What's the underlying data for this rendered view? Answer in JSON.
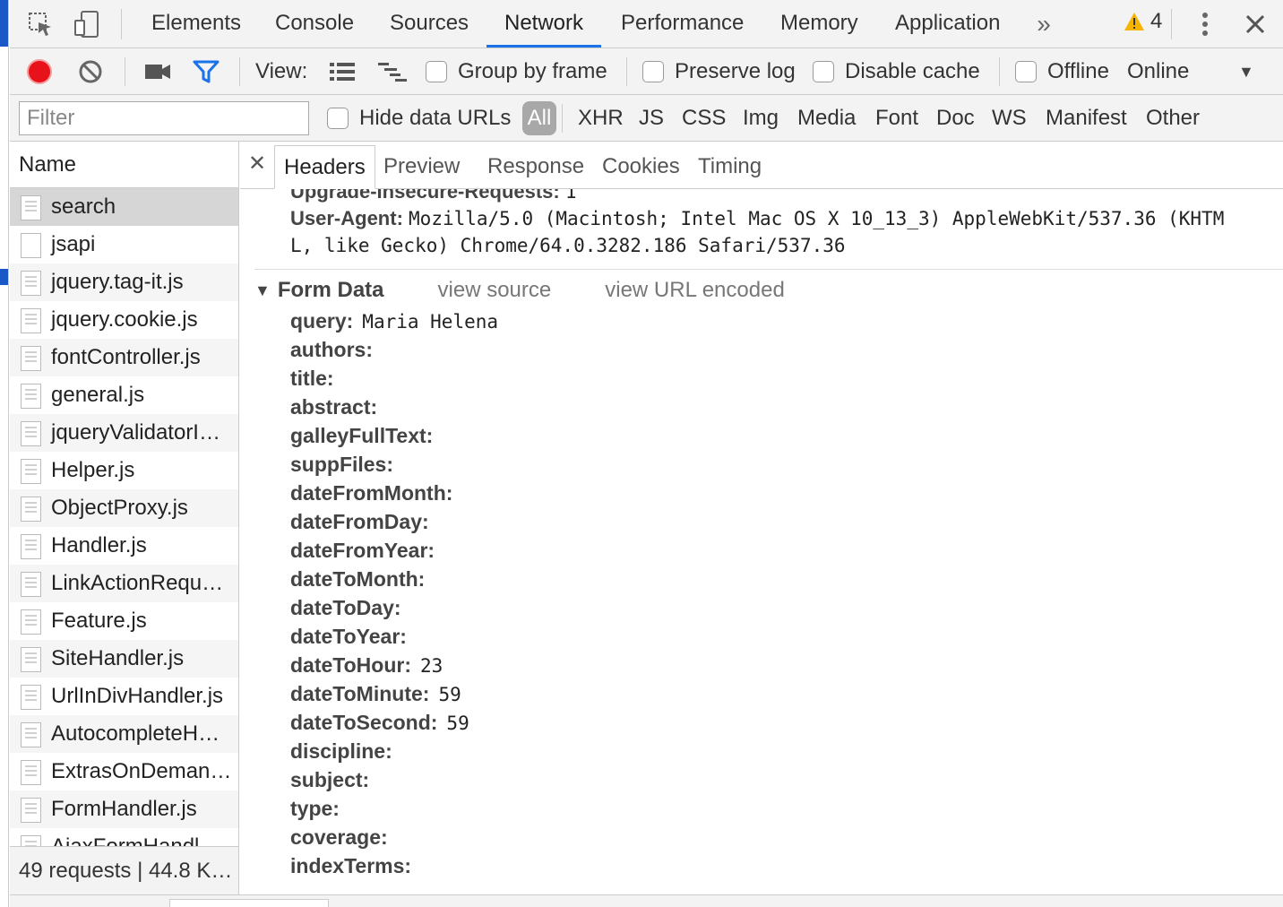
{
  "top_tabs": [
    "Elements",
    "Console",
    "Sources",
    "Network",
    "Performance",
    "Memory",
    "Application"
  ],
  "active_top_tab": "Network",
  "warning_count": "4",
  "toolbar": {
    "view_label": "View:",
    "group_by_frame": "Group by frame",
    "preserve_log": "Preserve log",
    "disable_cache": "Disable cache",
    "offline": "Offline",
    "throttle_value": "Online"
  },
  "filter": {
    "placeholder": "Filter",
    "hide_data_urls": "Hide data URLs",
    "types": [
      "All",
      "XHR",
      "JS",
      "CSS",
      "Img",
      "Media",
      "Font",
      "Doc",
      "WS",
      "Manifest",
      "Other"
    ]
  },
  "name_pane": {
    "header": "Name",
    "items": [
      "search",
      "jsapi",
      "jquery.tag-it.js",
      "jquery.cookie.js",
      "fontController.js",
      "general.js",
      "jqueryValidatorI…",
      "Helper.js",
      "ObjectProxy.js",
      "Handler.js",
      "LinkActionRequ…",
      "Feature.js",
      "SiteHandler.js",
      "UrlInDivHandler.js",
      "AutocompleteH…",
      "ExtrasOnDeman…",
      "FormHandler.js",
      "AjaxFormHandl…"
    ],
    "footer": "49 requests | 44.8 K…"
  },
  "detail_tabs": [
    "Headers",
    "Preview",
    "Response",
    "Cookies",
    "Timing"
  ],
  "request_headers": {
    "upgrade_key": "Upgrade-Insecure-Requests:",
    "upgrade_val": "1",
    "ua_key": "User-Agent:",
    "ua_val_line1": "Mozilla/5.0 (Macintosh; Intel Mac OS X 10_13_3) AppleWebKit/537.36 (KHTM",
    "ua_val_line2": "L, like Gecko) Chrome/64.0.3282.186 Safari/537.36"
  },
  "form_data": {
    "title": "Form Data",
    "view_source": "view source",
    "view_url_encoded": "view URL encoded",
    "fields": [
      {
        "key": "query:",
        "value": "Maria Helena"
      },
      {
        "key": "authors:",
        "value": ""
      },
      {
        "key": "title:",
        "value": ""
      },
      {
        "key": "abstract:",
        "value": ""
      },
      {
        "key": "galleyFullText:",
        "value": ""
      },
      {
        "key": "suppFiles:",
        "value": ""
      },
      {
        "key": "dateFromMonth:",
        "value": ""
      },
      {
        "key": "dateFromDay:",
        "value": ""
      },
      {
        "key": "dateFromYear:",
        "value": ""
      },
      {
        "key": "dateToMonth:",
        "value": ""
      },
      {
        "key": "dateToDay:",
        "value": ""
      },
      {
        "key": "dateToYear:",
        "value": ""
      },
      {
        "key": "dateToHour:",
        "value": "23"
      },
      {
        "key": "dateToMinute:",
        "value": "59"
      },
      {
        "key": "dateToSecond:",
        "value": "59"
      },
      {
        "key": "discipline:",
        "value": ""
      },
      {
        "key": "subject:",
        "value": ""
      },
      {
        "key": "type:",
        "value": ""
      },
      {
        "key": "coverage:",
        "value": ""
      },
      {
        "key": "indexTerms:",
        "value": ""
      }
    ]
  },
  "colors": {
    "accent": "#1a73e8",
    "record": "#e8121a",
    "filter_icon": "#1a73e8",
    "warning": "#f4b400"
  }
}
